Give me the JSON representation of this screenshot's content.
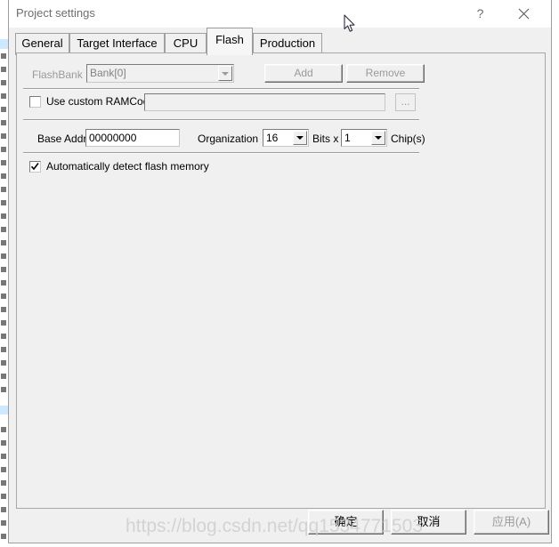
{
  "window": {
    "title": "Project settings",
    "help_label": "?",
    "close_label": "✕"
  },
  "tabs": [
    {
      "label": "General",
      "selected": false
    },
    {
      "label": "Target Interface",
      "selected": false
    },
    {
      "label": "CPU",
      "selected": false
    },
    {
      "label": "Flash",
      "selected": true
    },
    {
      "label": "Production",
      "selected": false
    }
  ],
  "flash_tab": {
    "flashbank": {
      "label": "FlashBank",
      "value": "Bank[0]",
      "enabled": false
    },
    "add_button": {
      "label": "Add",
      "enabled": false
    },
    "remove_button": {
      "label": "Remove",
      "enabled": false
    },
    "use_custom_ramcode": {
      "label": "Use custom RAMCode",
      "checked": false
    },
    "ramcode_path": {
      "value": "",
      "placeholder": "",
      "enabled": false
    },
    "browse_button": {
      "label": "...",
      "enabled": false
    },
    "base_addr": {
      "label": "Base Addr",
      "value": "00000000"
    },
    "organization": {
      "label": "Organization",
      "value": "16"
    },
    "bits_x": {
      "label": "Bits x",
      "value": "1"
    },
    "chips_label": "Chip(s)",
    "auto_detect": {
      "label": "Automatically detect flash memory",
      "checked": true
    }
  },
  "footer": {
    "ok_label": "确定",
    "cancel_label": "取消",
    "apply_label": "应用(A)",
    "apply_enabled": false
  },
  "watermark": "https://blog.csdn.net/qq1534771503",
  "colors": {
    "dialog_face": "#f0f0f0",
    "titlebar": "#ffffff",
    "title_text": "#6e6e6e",
    "border": "#9e9e9e",
    "disabled_text": "#9a9a9a",
    "watermark": "#cfcfcf"
  }
}
